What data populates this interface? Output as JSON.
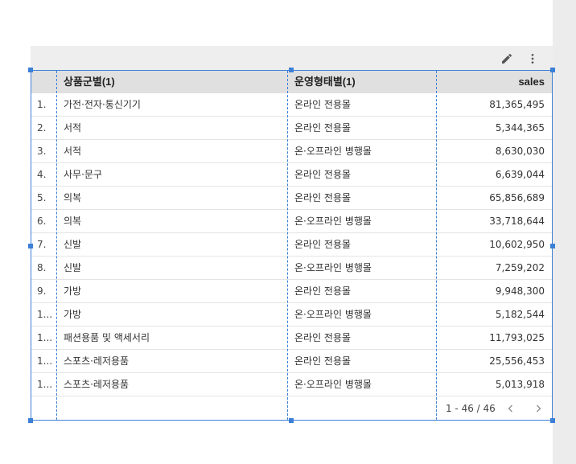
{
  "table": {
    "columns": [
      "상품군별(1)",
      "운영형태별(1)",
      "sales"
    ],
    "rows": [
      {
        "idx": "1.",
        "category": "가전·전자·통신기기",
        "type": "온라인 전용몰",
        "sales": "81,365,495"
      },
      {
        "idx": "2.",
        "category": "서적",
        "type": "온라인 전용몰",
        "sales": "5,344,365"
      },
      {
        "idx": "3.",
        "category": "서적",
        "type": "온·오프라인 병행몰",
        "sales": "8,630,030"
      },
      {
        "idx": "4.",
        "category": "사무·문구",
        "type": "온라인 전용몰",
        "sales": "6,639,044"
      },
      {
        "idx": "5.",
        "category": "의복",
        "type": "온라인 전용몰",
        "sales": "65,856,689"
      },
      {
        "idx": "6.",
        "category": "의복",
        "type": "온·오프라인 병행몰",
        "sales": "33,718,644"
      },
      {
        "idx": "7.",
        "category": "신발",
        "type": "온라인 전용몰",
        "sales": "10,602,950"
      },
      {
        "idx": "8.",
        "category": "신발",
        "type": "온·오프라인 병행몰",
        "sales": "7,259,202"
      },
      {
        "idx": "9.",
        "category": "가방",
        "type": "온라인 전용몰",
        "sales": "9,948,300"
      },
      {
        "idx": "1...",
        "category": "가방",
        "type": "온·오프라인 병행몰",
        "sales": "5,182,544"
      },
      {
        "idx": "1...",
        "category": "패션용품 및 액세서리",
        "type": "온라인 전용몰",
        "sales": "11,793,025"
      },
      {
        "idx": "1...",
        "category": "스포츠·레저용품",
        "type": "온라인 전용몰",
        "sales": "25,556,453"
      },
      {
        "idx": "1...",
        "category": "스포츠·레저용품",
        "type": "온·오프라인 병행몰",
        "sales": "5,013,918"
      }
    ]
  },
  "pagination": {
    "label": "1 - 46 / 46"
  },
  "icons": {
    "edit": "pencil-icon",
    "more": "more-vert-icon",
    "prev": "chevron-left-icon",
    "next": "chevron-right-icon"
  },
  "colors": {
    "selection": "#3c7fd6",
    "header_bg": "#e0e0e0",
    "toolbar_bg": "#eeeeee"
  }
}
